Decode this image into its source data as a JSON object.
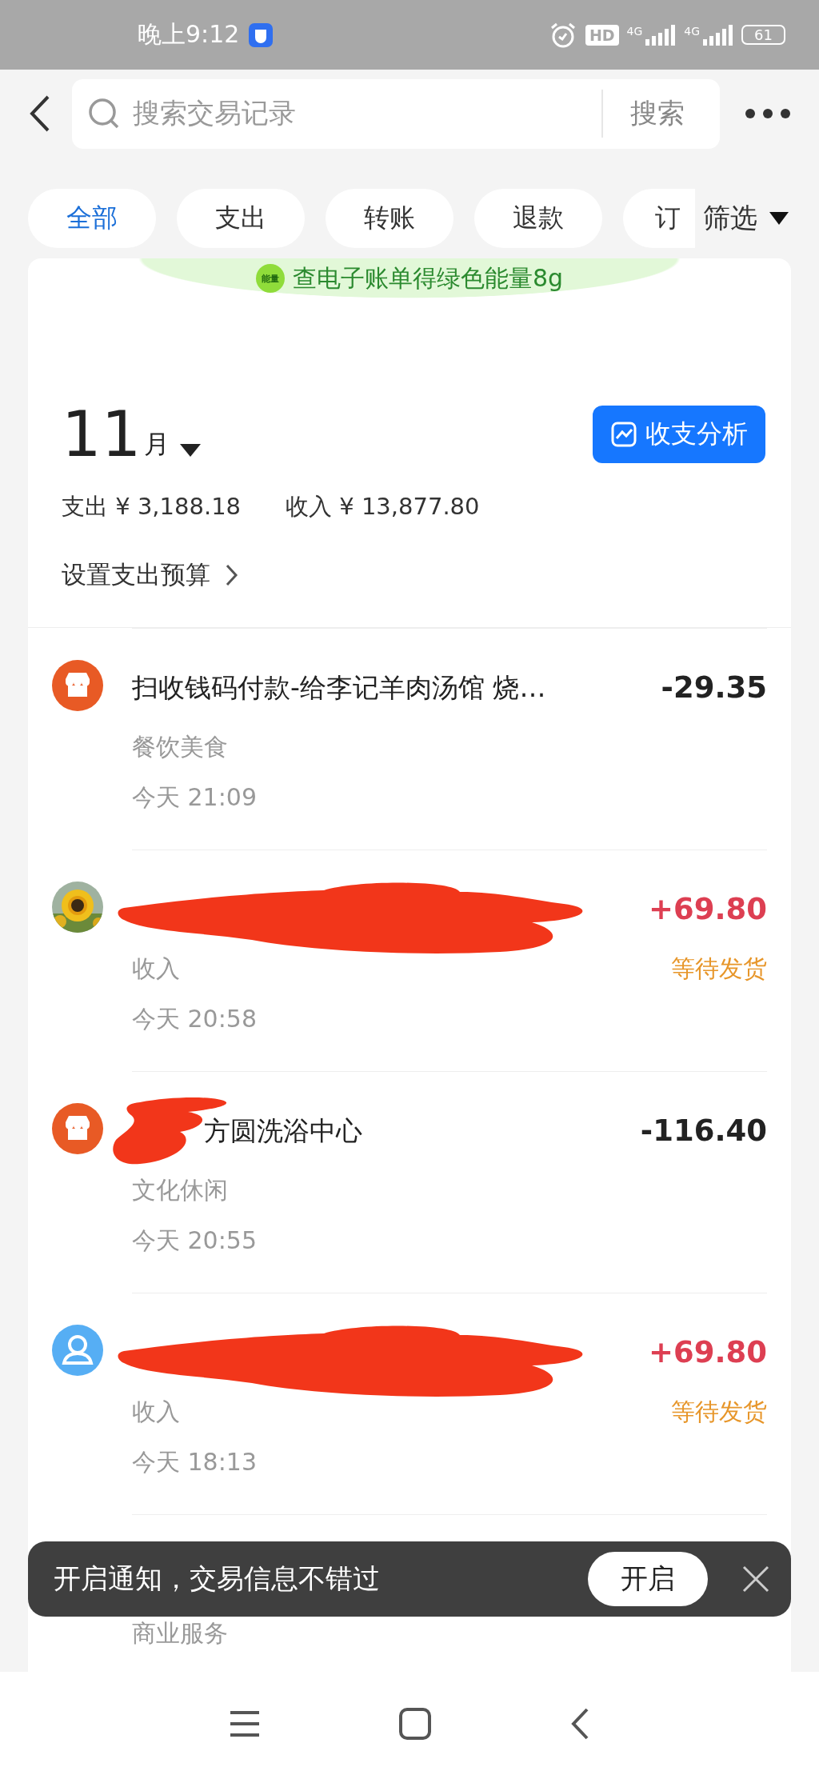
{
  "status_bar": {
    "time": "晚上9:12",
    "hd": "HD",
    "networks": [
      "4G",
      "4G"
    ],
    "battery": "61"
  },
  "search": {
    "placeholder": "搜索交易记录",
    "button": "搜索"
  },
  "filters": [
    {
      "label": "全部",
      "selected": true
    },
    {
      "label": "支出",
      "selected": false
    },
    {
      "label": "转账",
      "selected": false
    },
    {
      "label": "退款",
      "selected": false
    },
    {
      "label": "订",
      "selected": false
    }
  ],
  "filter_button": "筛选",
  "banner": {
    "badge": "能量",
    "text": "查电子账单得绿色能量8g"
  },
  "month": {
    "number": "11",
    "unit": "月"
  },
  "analysis_button": "收支分析",
  "summary": {
    "expense": "支出 ¥ 3,188.18",
    "income": "收入 ¥ 13,877.80"
  },
  "budget_link": "设置支出预算",
  "transactions": [
    {
      "avatar": {
        "kind": "shop"
      },
      "title": "扫收钱码付款-给李记羊肉汤馆 烧…",
      "category": "餐饮美食",
      "time": "今天 21:09",
      "amount": "-29.35",
      "kind": "expense"
    },
    {
      "redaction": {
        "kind": "full"
      },
      "category": "收入",
      "time": "今天 20:58",
      "amount": "+69.80",
      "kind": "income",
      "status": "等待发货"
    },
    {
      "avatar": {
        "kind": "shop"
      },
      "redaction": {
        "kind": "partial"
      },
      "title": "方圆洗浴中心",
      "category": "文化休闲",
      "time": "今天 20:55",
      "amount": "-116.40",
      "kind": "expense"
    },
    {
      "avatar": {
        "kind": "person"
      },
      "redaction": {
        "kind": "full"
      },
      "category": "收入",
      "time": "今天 18:13",
      "amount": "+69.80",
      "kind": "income",
      "status": "等待发货"
    },
    {
      "category": "商业服务"
    }
  ],
  "toast": {
    "message": "开启通知，交易信息不错过",
    "button": "开启"
  }
}
